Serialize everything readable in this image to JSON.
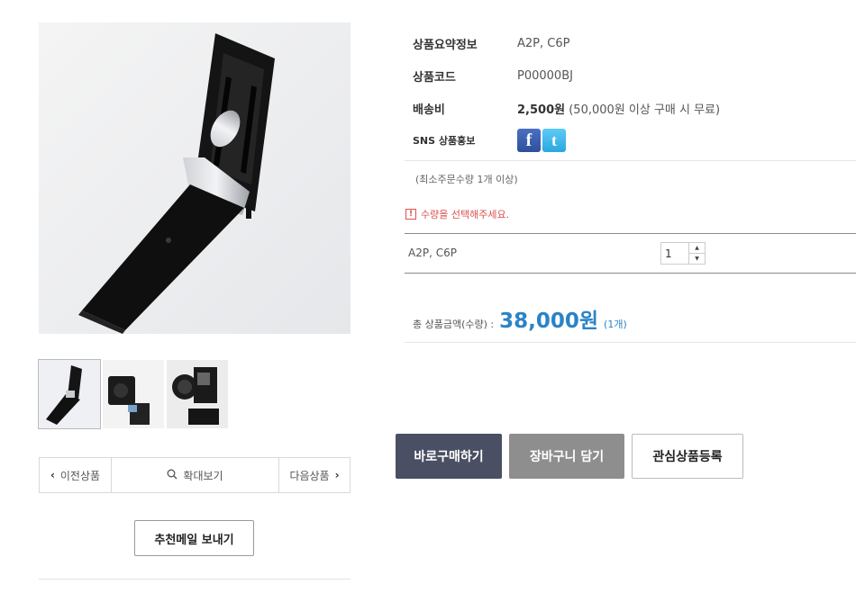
{
  "product": {
    "summary_label": "상품요약정보",
    "summary_value": "A2P, C6P",
    "code_label": "상품코드",
    "code_value": "P00000BJ",
    "shipping_label": "배송비",
    "shipping_price": "2,500원",
    "shipping_note": "(50,000원 이상 구매 시 무료)",
    "sns_label": "SNS 상품홍보",
    "sns_icons": [
      "facebook-icon",
      "twitter-icon"
    ]
  },
  "order": {
    "min_order": "(최소주문수량 1개 이상)",
    "warning": "수량을 선택해주세요.",
    "option_name": "A2P, C6P",
    "quantity": "1",
    "total_label": "총 상품금액(수량) :",
    "total_price": "38,000원",
    "total_count": "(1개)"
  },
  "gallery": {
    "prev": "이전상품",
    "zoom": "확대보기",
    "next": "다음상품",
    "recommend": "추천메일 보내기"
  },
  "actions": {
    "buy": "바로구매하기",
    "cart": "장바구니 담기",
    "wish": "관심상품등록"
  },
  "colors": {
    "price": "#2a83c6",
    "buy_button": "#4a4f63",
    "cart_button": "#8e8e8e",
    "warning": "#d8534f"
  }
}
